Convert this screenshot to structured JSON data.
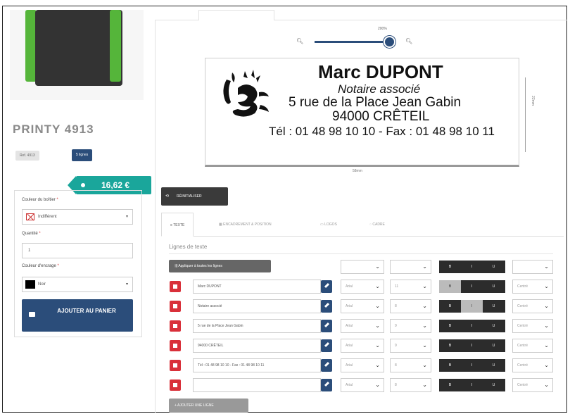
{
  "product": {
    "title": "PRINTY 4913",
    "ref_badge": "Ref. 4913",
    "lines_badge": "5 lignes",
    "price": "16,62 €"
  },
  "options": {
    "case_color_label": "Couleur du boîtier",
    "case_color_value": "Indifférent",
    "quantity_label": "Quantité",
    "quantity_value": "1",
    "ink_color_label": "Couleur d'encrage",
    "ink_color_value": "Noir",
    "add_to_cart": "AJOUTER AU PANIER",
    "required_mark": "*"
  },
  "zoom": {
    "percent": "200%",
    "level": 1.0
  },
  "preview": {
    "lines": [
      "Marc DUPONT",
      "Notaire associé",
      "5 rue de la Place Jean Gabin",
      "94000 CRÊTEIL",
      "Tél : 01 48 98 10 10 - Fax : 01 48 98 10 11"
    ],
    "width_label": "58mm",
    "height_label": "22mm"
  },
  "toolbar": {
    "reset_label": "RÉINITIALISER"
  },
  "tabs": [
    "TEXTE",
    "ENCADREMENT & POSITION",
    "LOGOS",
    "CADRE"
  ],
  "lines_section": {
    "title": "Lignes de texte",
    "apply_all": "Appliquer à toutes les lignes",
    "format_labels": [
      "B",
      "I",
      "U"
    ],
    "rows": [
      {
        "text": "Marc DUPONT",
        "font": "Arial",
        "size": "11",
        "align": "Centré"
      },
      {
        "text": "Notaire associé",
        "font": "Arial",
        "size": "8",
        "align": "Centré"
      },
      {
        "text": "5 rue de la Place Jean Gabin",
        "font": "Arial",
        "size": "9",
        "align": "Centré"
      },
      {
        "text": "94000 CRÊTEIL",
        "font": "Arial",
        "size": "9",
        "align": "Centré"
      },
      {
        "text": "Tél : 01 48 98 10 10 - Fax : 01 48 98 10 11",
        "font": "Arial",
        "size": "8",
        "align": "Centré"
      },
      {
        "text": "",
        "font": "Arial",
        "size": "8",
        "align": "Centré"
      }
    ],
    "add_line": "AJOUTER UNE LIGNE"
  }
}
